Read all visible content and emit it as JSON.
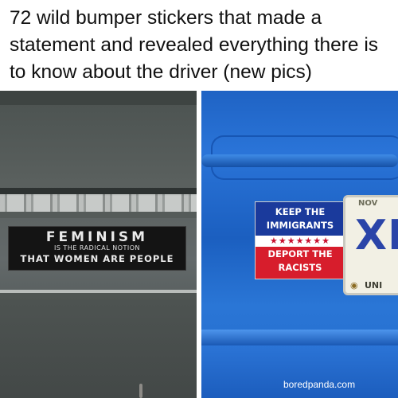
{
  "headline": "72 wild bumper stickers that made a statement and revealed everything there is to know about the driver (new pics)",
  "left_photo": {
    "sticker": {
      "line1": "FEMINISM",
      "line2": "IS THE RADICAL NOTION",
      "line3": "THAT WOMEN ARE PEOPLE"
    }
  },
  "right_photo": {
    "sticker": {
      "line1": "KEEP THE",
      "line2": "IMMIGRANTS",
      "stars": "★★★★★★★",
      "line3": "DEPORT THE",
      "line4": "RACISTS"
    },
    "plate": {
      "top": "NOV",
      "main": "XD",
      "bottom": "UNI"
    }
  },
  "watermark": "boredpanda.com",
  "colors": {
    "car_blue": "#2369c9",
    "sticker_blue": "#1a3a9c",
    "sticker_red": "#d71d2c",
    "bumper_gray": "#5a605e"
  }
}
